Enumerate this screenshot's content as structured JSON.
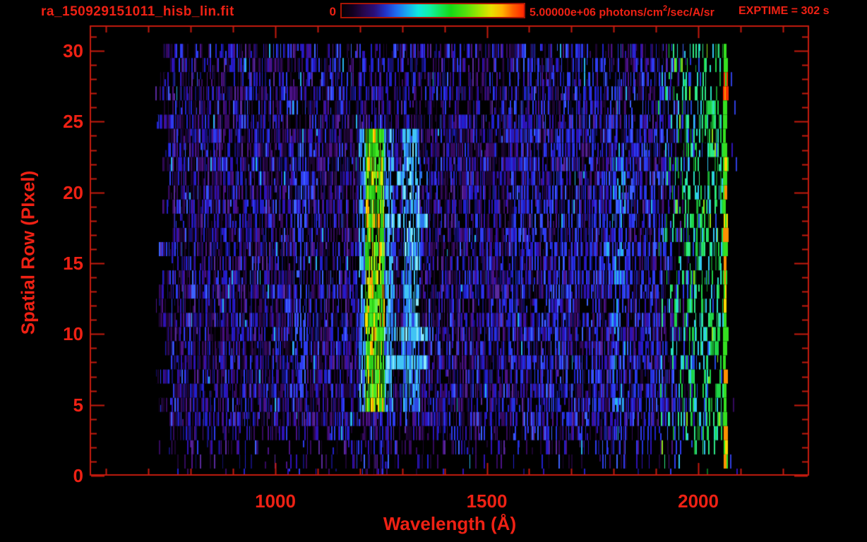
{
  "window": {
    "title": "ra_150929151011_hisb_lin.fit",
    "exptime_label": "EXPTIME = 302 s"
  },
  "colorbar": {
    "min_label": "0",
    "max_label_prefix": "5.00000e+06 photons/cm",
    "max_label_sup": "2",
    "max_label_suffix": "/sec/A/sr"
  },
  "colors": {
    "text": "#ee2114",
    "axis": "#c41b0e",
    "background": "#000000",
    "colorbar_border": "#a81505"
  },
  "chart_data": {
    "type": "heatmap",
    "title": "ra_150929151011_hisb_lin.fit",
    "xlabel": "Wavelength (Å)",
    "ylabel": "Spatial Row (PIxel)",
    "xlim": [
      561,
      2262
    ],
    "ylim": [
      0,
      31.8
    ],
    "x_ticks_major": [
      1000,
      1500,
      2000
    ],
    "x_minor_step": 100,
    "x_minor_range": [
      600,
      2200
    ],
    "y_ticks_major": [
      0,
      5,
      10,
      15,
      20,
      25,
      30
    ],
    "y_minor_step": 1,
    "y_minor_range": [
      0,
      31
    ],
    "value_scale": {
      "min": 0,
      "max": 5000000,
      "max_label": "5.00000e+06",
      "units": "photons/cm^2/sec/A/sr"
    },
    "exposure_time_s": 302,
    "seed": 20150929,
    "data_extent": {
      "wavelength": [
        730,
        2070
      ],
      "rows": [
        0,
        30
      ]
    },
    "noise": {
      "row_density": {
        "0": 0.06,
        "1": 0.13,
        "2": 0.3,
        "3": 0.5,
        "default": 0.78,
        "upper_25_30": 0.68
      },
      "palette": [
        [
          "#1b0530",
          22
        ],
        [
          "#35095e",
          16
        ],
        [
          "#4b1287",
          9
        ],
        [
          "#2e12b5",
          13
        ],
        [
          "#2020cc",
          12
        ],
        [
          "#2e3cf0",
          10
        ],
        [
          "#120f6e",
          9
        ],
        [
          "#5a2a9e",
          5
        ],
        [
          "#3d62ff",
          3
        ],
        [
          "#27b4ee",
          1
        ]
      ],
      "blue_boost_palette": [
        [
          "#2e3cf0",
          40
        ],
        [
          "#2233dd",
          25
        ],
        [
          "#3d62ff",
          20
        ],
        [
          "#2e12b5",
          15
        ]
      ],
      "blue_boost_wl": 1550,
      "green_palette": [
        [
          "#1ed447",
          28
        ],
        [
          "#2ee886",
          18
        ],
        [
          "#27e0c0",
          14
        ],
        [
          "#31c8f2",
          12
        ],
        [
          "#2347dd",
          10
        ],
        [
          "#179a2b",
          10
        ],
        [
          "#8fe41a",
          4
        ],
        [
          "#0d6e1e",
          4
        ]
      ],
      "green_start_wl": 1900,
      "green_full_wl": 1990,
      "green_density": 0.55,
      "under_line_rows_boost": {
        "rows": [
          0,
          2
        ],
        "wl": [
          1205,
          1270
        ],
        "density": 0.45
      }
    },
    "features": [
      {
        "name": "edge_emission_column",
        "wl": [
          2058,
          2070
        ],
        "rows": [
          1,
          30
        ],
        "density": 1.0,
        "palette": [
          [
            "#35e020",
            55
          ],
          [
            "#ffd900",
            25
          ],
          [
            "#ff9100",
            20
          ]
        ],
        "red_rows": [
          27,
          28
        ],
        "red_color": "#ff2f00"
      },
      {
        "name": "lyman_alpha_core",
        "wl": [
          1212,
          1256
        ],
        "rows": [
          5,
          24
        ],
        "density": 0.97,
        "palette": [
          [
            "#2ccc17",
            38
          ],
          [
            "#3fe824",
            18
          ],
          [
            "#a8e40e",
            14
          ],
          [
            "#ffe000",
            14
          ],
          [
            "#ff9e00",
            7
          ],
          [
            "#63f04c",
            5
          ],
          [
            "#1a9e10",
            4
          ]
        ]
      },
      {
        "name": "row-bridge-8",
        "wl": [
          1256,
          1360
        ],
        "rows": [
          8,
          8
        ],
        "density": 0.85,
        "palette": [
          [
            "#41c4f4",
            50
          ],
          [
            "#2a74ee",
            28
          ],
          [
            "#8ce8fa",
            22
          ]
        ]
      },
      {
        "name": "row-bridge-10",
        "wl": [
          1256,
          1360
        ],
        "rows": [
          10,
          10
        ],
        "density": 0.8,
        "palette": [
          [
            "#41c4f4",
            50
          ],
          [
            "#2a74ee",
            28
          ],
          [
            "#8ce8fa",
            22
          ]
        ]
      },
      {
        "name": "row-bridge-18",
        "wl": [
          1256,
          1360
        ],
        "rows": [
          18,
          18
        ],
        "density": 0.7,
        "palette": [
          [
            "#41c4f4",
            45
          ],
          [
            "#2a74ee",
            35
          ],
          [
            "#8ce8fa",
            20
          ]
        ]
      },
      {
        "name": "row-bridge-21",
        "wl": [
          1256,
          1360
        ],
        "rows": [
          21,
          21
        ],
        "density": 0.7,
        "palette": [
          [
            "#41c4f4",
            45
          ],
          [
            "#2a74ee",
            35
          ],
          [
            "#8ce8fa",
            20
          ]
        ]
      },
      {
        "name": "lyman_fringe_left",
        "wl": [
          1196,
          1212
        ],
        "rows": [
          5,
          24
        ],
        "density": 0.85,
        "palette": [
          [
            "#3fbef4",
            38
          ],
          [
            "#2a74ee",
            28
          ],
          [
            "#2f3fe0",
            22
          ],
          [
            "#70d8f8",
            12
          ]
        ]
      },
      {
        "name": "lyman_fringe_right",
        "wl": [
          1256,
          1278
        ],
        "rows": [
          5,
          24
        ],
        "density": 0.85,
        "palette": [
          [
            "#3fbef4",
            38
          ],
          [
            "#2a74ee",
            28
          ],
          [
            "#2f3fe0",
            22
          ],
          [
            "#70d8f8",
            12
          ]
        ]
      },
      {
        "name": "secondary_line_1300",
        "wl": [
          1300,
          1340
        ],
        "rows": [
          5,
          24
        ],
        "density": 0.9,
        "split_row": 10,
        "palette": [
          [
            "#41c4f4",
            42
          ],
          [
            "#2a85ee",
            26
          ],
          [
            "#2f48e2",
            20
          ],
          [
            "#8ce8fa",
            12
          ]
        ],
        "palette_low": [
          [
            "#2f48e2",
            45
          ],
          [
            "#2a74ee",
            30
          ],
          [
            "#41c4f4",
            25
          ]
        ]
      },
      {
        "name": "line_1060",
        "wl": [
          1042,
          1072
        ],
        "rows": [
          6,
          23
        ],
        "density": 0.72,
        "palette": [
          [
            "#2e3cf0",
            45
          ],
          [
            "#2e12b5",
            30
          ],
          [
            "#3d62ff",
            25
          ]
        ]
      },
      {
        "name": "line_1800",
        "wl": [
          1795,
          1826
        ],
        "rows": [
          3,
          23
        ],
        "density": 0.72,
        "palette": [
          [
            "#2e3cf0",
            35
          ],
          [
            "#27b4ee",
            22
          ],
          [
            "#2e12b5",
            25
          ],
          [
            "#3d62ff",
            18
          ]
        ]
      }
    ],
    "gap_strips": [
      {
        "wl": 2077,
        "row": 28,
        "color": "#2f3fe0"
      },
      {
        "wl": 2085,
        "row": 26,
        "color": "#2f3fe0"
      },
      {
        "wl": 2079,
        "row": 23,
        "color": "#2e12b5"
      },
      {
        "wl": 2088,
        "row": 22,
        "color": "#2f3fe0"
      },
      {
        "wl": 2082,
        "row": 5,
        "color": "#35095e"
      },
      {
        "wl": 2075,
        "row": 1,
        "color": "#2f3fe0"
      },
      {
        "wl": 2090,
        "row": 0,
        "color": "#2e12b5"
      },
      {
        "wl": 1953,
        "row": 1,
        "color": "#31c8f2"
      }
    ]
  }
}
